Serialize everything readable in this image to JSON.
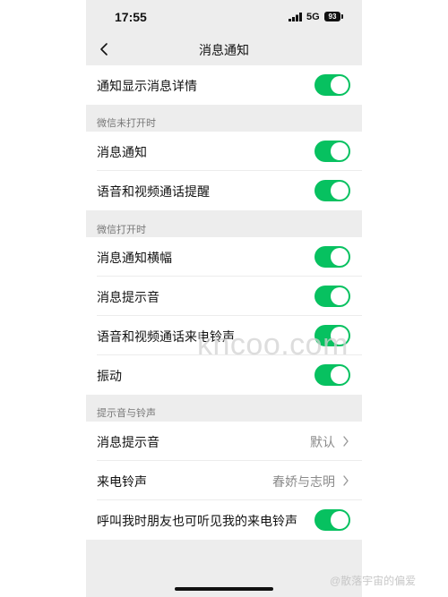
{
  "status_bar": {
    "time": "17:55",
    "network": "5G",
    "battery": "93",
    "icons": [
      "signal-bars-icon",
      "battery-icon"
    ]
  },
  "nav": {
    "title": "消息通知",
    "back_icon": "chevron-left-icon"
  },
  "colors": {
    "accent": "#07c160",
    "page_background": "#ededed",
    "row_background": "#ffffff",
    "secondary_text": "#8a8a8a"
  },
  "rows": {
    "show_details": {
      "label": "通知显示消息详情",
      "enabled": true
    },
    "section_not_open": "微信未打开时",
    "msg_notify": {
      "label": "消息通知",
      "enabled": true
    },
    "voice_video_alert": {
      "label": "语音和视频通话提醒",
      "enabled": true
    },
    "section_open": "微信打开时",
    "banner": {
      "label": "消息通知横幅",
      "enabled": true
    },
    "msg_sound": {
      "label": "消息提示音",
      "enabled": true
    },
    "call_ringtone_toggle": {
      "label": "语音和视频通话来电铃声",
      "enabled": true
    },
    "vibrate": {
      "label": "振动",
      "enabled": true
    },
    "section_sounds": "提示音与铃声",
    "msg_sound_select": {
      "label": "消息提示音",
      "value": "默认"
    },
    "ringtone_select": {
      "label": "来电铃声",
      "value": "春娇与志明"
    },
    "friends_hear": {
      "label": "呼叫我时朋友也可听见我的来电铃声",
      "enabled": true
    }
  },
  "overlay": {
    "watermark": "kncoo.com",
    "credit": "@散落宇宙的偏爱"
  }
}
